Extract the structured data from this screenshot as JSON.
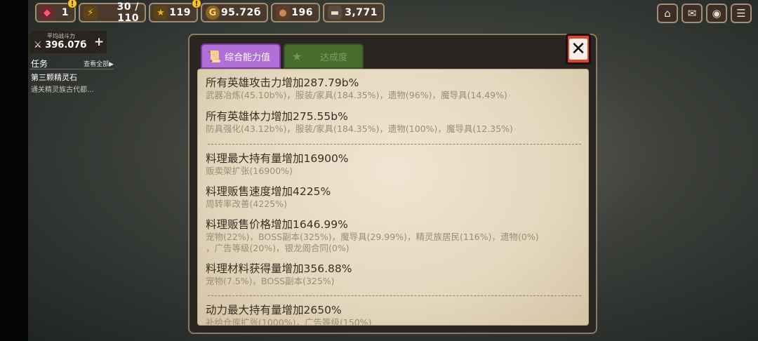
{
  "resources": [
    {
      "name": "gem",
      "value": "1",
      "icon": "gem-icon",
      "color": "#d8324a"
    },
    {
      "name": "energy",
      "value": "30 / 110",
      "icon": "lightning-icon",
      "color": "#f4c431"
    },
    {
      "name": "stars",
      "value": "119",
      "icon": "star-lightning-icon",
      "color": "#f0b030"
    },
    {
      "name": "gold",
      "value": "95.72б",
      "icon": "coin-icon",
      "color": "#d8a548"
    },
    {
      "name": "materials",
      "value": "196",
      "icon": "ore-icon",
      "color": "#a0704a"
    },
    {
      "name": "wood",
      "value": "3,771",
      "icon": "log-icon",
      "color": "#c9b69c"
    }
  ],
  "warnings": {
    "symbol": "!"
  },
  "menu_icons": [
    "home-upgrade-icon",
    "mail-icon",
    "camera-icon",
    "menu-icon"
  ],
  "power": {
    "label": "平均战斗力",
    "value": "396.07б",
    "icon": "crossed-swords-icon",
    "plus": "+"
  },
  "quest": {
    "title": "任务",
    "view_all": "查看全部▶",
    "name": "第三颗精灵石",
    "desc": "通关精灵族古代都..."
  },
  "tabs": [
    {
      "label": "综合能力值",
      "active": true,
      "icon": "scroll-icon"
    },
    {
      "label": "达成度",
      "active": false,
      "icon": "star-badge-icon"
    }
  ],
  "close_label": "✕",
  "stats": [
    {
      "title": "所有英雄攻击力增加287.79b%",
      "detail": [
        "武器冶炼(45.10b%)，服装/家具(184.35%)，遗物(96%)，魔导具(14.49%)"
      ]
    },
    {
      "title": "所有英雄体力增加275.55b%",
      "detail": [
        "防具强化(43.12b%)，服装/家具(184.35%)，遗物(100%)，魔导具(12.35%)"
      ]
    },
    {
      "title": "料理最大持有量增加16900%",
      "detail": [
        "贩卖架扩张(16900%)"
      ]
    },
    {
      "title": "料理贩售速度增加4225%",
      "detail": [
        "周转率改善(4225%)"
      ]
    },
    {
      "title": "料理贩售价格增加1646.99%",
      "detail": [
        "宠物(22%)，BOSS副本(325%)，魔导具(29.99%)，精灵族居民(116%)，遗物(0%)",
        "，广告等级(20%)，银龙阁合同(0%)"
      ]
    },
    {
      "title": "料理材料获得量增加356.88%",
      "detail": [
        "宠物(7.5%)，BOSS副本(325%)"
      ]
    },
    {
      "title": "动力最大持有量增加2650%",
      "detail": [
        "补给仓库扩张(1000%)，广告等级(150%)"
      ]
    }
  ]
}
